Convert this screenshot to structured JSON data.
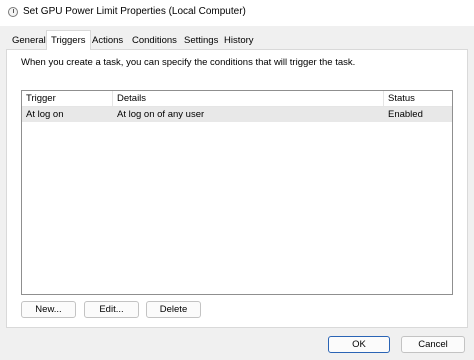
{
  "window": {
    "title": "Set GPU Power Limit Properties (Local Computer)",
    "icon": "clock-icon"
  },
  "tabs": [
    {
      "label": "General",
      "active": false
    },
    {
      "label": "Triggers",
      "active": true
    },
    {
      "label": "Actions",
      "active": false
    },
    {
      "label": "Conditions",
      "active": false
    },
    {
      "label": "Settings",
      "active": false
    },
    {
      "label": "History",
      "active": false
    }
  ],
  "triggers": {
    "description": "When you create a task, you can specify the conditions that will trigger the task.",
    "columns": [
      "Trigger",
      "Details",
      "Status"
    ],
    "rows": [
      {
        "trigger": "At log on",
        "details": "At log on of any user",
        "status": "Enabled",
        "selected": true
      }
    ],
    "buttons": {
      "new": "New...",
      "edit": "Edit...",
      "delete": "Delete"
    }
  },
  "footer": {
    "ok": "OK",
    "cancel": "Cancel"
  },
  "colors": {
    "selected_row": "#e8e8e8",
    "default_button_border": "#2a64b5"
  }
}
